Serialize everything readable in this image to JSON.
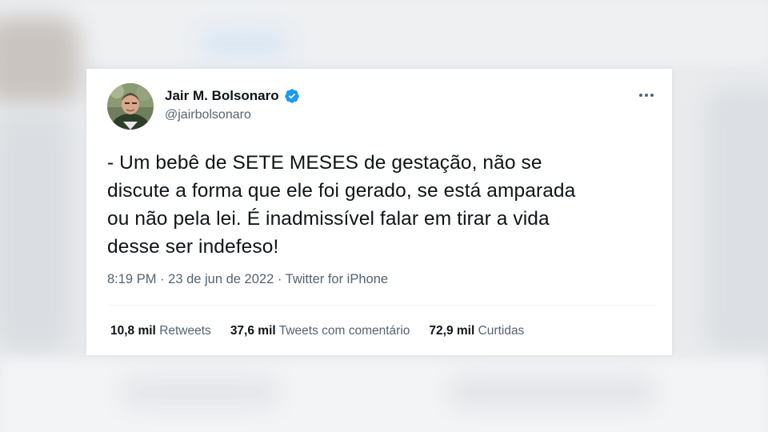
{
  "tweet": {
    "author_name": "Jair M. Bolsonaro",
    "handle": "@jairbolsonaro",
    "verified": true,
    "text_lines": [
      "- Um bebê de SETE MESES de gestação, não se",
      "discute a forma que ele foi gerado, se está amparada",
      "ou não pela lei. É inadmissível falar em tirar a vida",
      "desse ser indefeso!"
    ],
    "time": "8:19 PM",
    "separator": "·",
    "date": "23 de jun de 2022",
    "source": "Twitter for iPhone",
    "stats": {
      "retweets_count": "10,8 mil",
      "retweets_label": "Retweets",
      "quotes_count": "37,6 mil",
      "quotes_label": "Tweets com comentário",
      "likes_count": "72,9 mil",
      "likes_label": "Curtidas"
    }
  },
  "icons": {
    "verified": "verified-badge-icon",
    "more": "more-horizontal-icon"
  },
  "colors": {
    "verified_blue": "#1d9bf0",
    "text_primary": "#0f1419",
    "text_secondary": "#536471"
  }
}
